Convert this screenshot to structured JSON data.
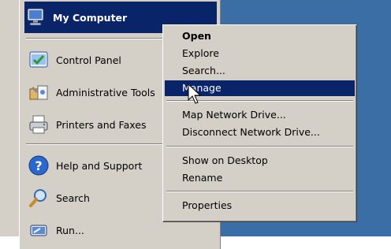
{
  "start_menu": {
    "items": [
      {
        "label": "My Computer",
        "icon": "my-computer-icon"
      },
      {
        "label": "Control Panel",
        "icon": "control-panel-icon"
      },
      {
        "label": "Administrative Tools",
        "icon": "administrative-tools-icon"
      },
      {
        "label": "Printers and Faxes",
        "icon": "printer-icon"
      },
      {
        "label": "Help and Support",
        "icon": "help-icon"
      },
      {
        "label": "Search",
        "icon": "search-icon"
      },
      {
        "label": "Run...",
        "icon": "run-icon"
      }
    ]
  },
  "context_menu": {
    "items": [
      {
        "label": "Open"
      },
      {
        "label": "Explore"
      },
      {
        "label": "Search..."
      },
      {
        "label": "Manage"
      },
      {
        "label": "Map Network Drive..."
      },
      {
        "label": "Disconnect Network Drive..."
      },
      {
        "label": "Show on Desktop"
      },
      {
        "label": "Rename"
      },
      {
        "label": "Properties"
      }
    ]
  },
  "colors": {
    "menu_bg": "#d4d0c8",
    "highlight": "#0a246a",
    "desktop_blue": "#3a6ea5"
  }
}
